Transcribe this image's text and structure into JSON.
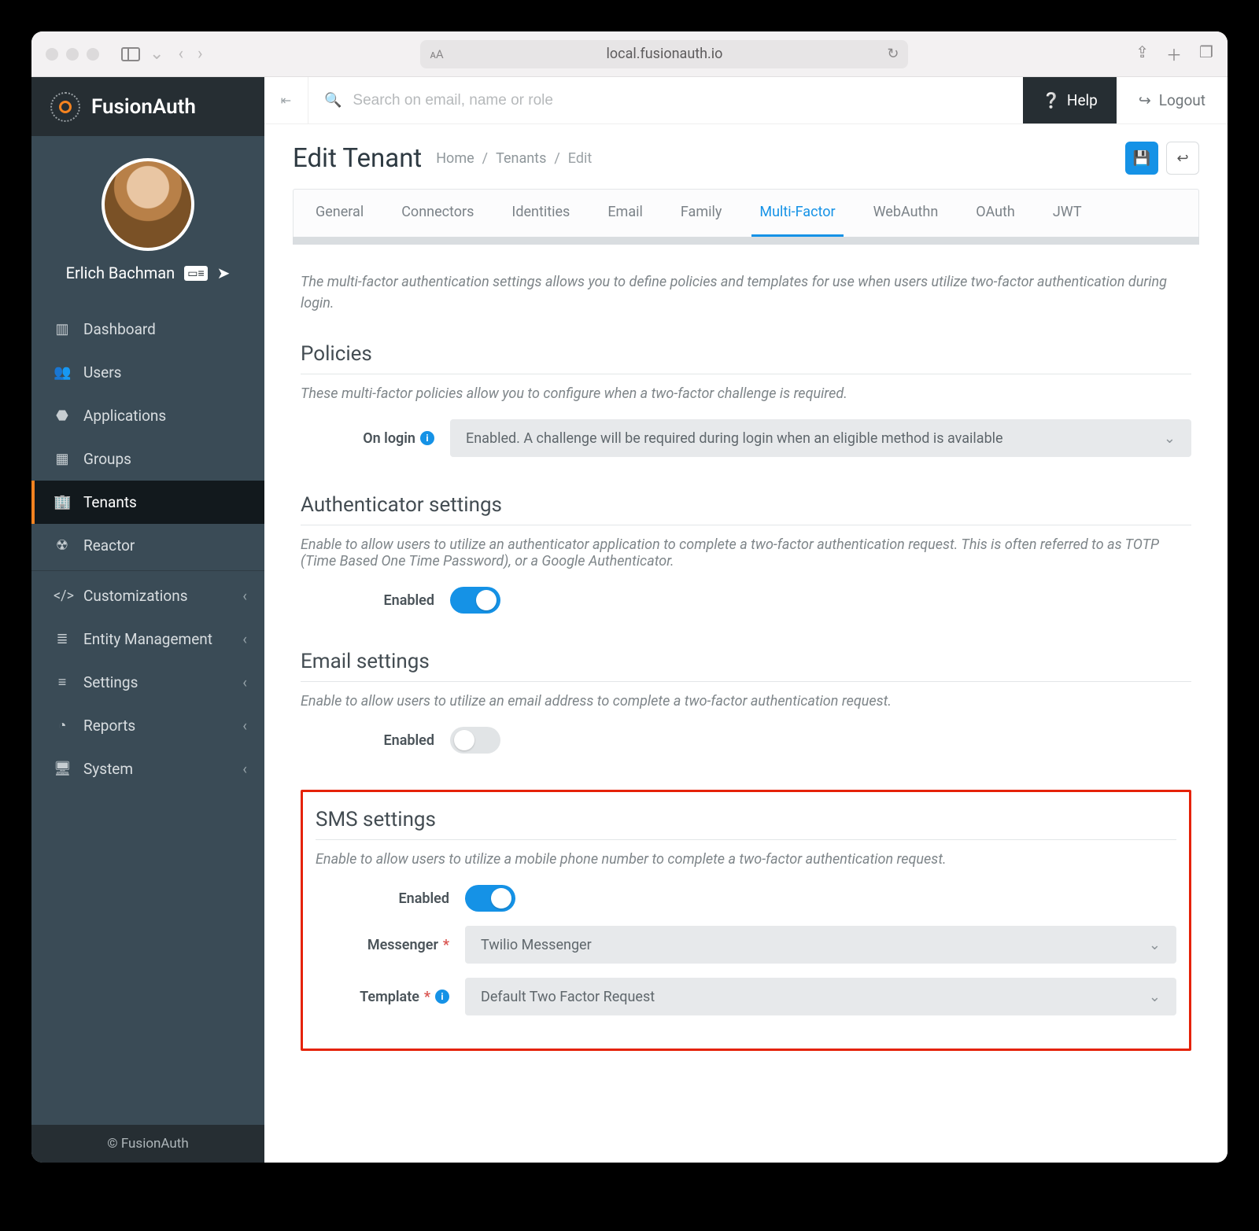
{
  "browser": {
    "url": "local.fusionauth.io"
  },
  "brand": "FusionAuth",
  "user": {
    "name": "Erlich Bachman"
  },
  "sidebar": {
    "items": [
      {
        "label": "Dashboard"
      },
      {
        "label": "Users"
      },
      {
        "label": "Applications"
      },
      {
        "label": "Groups"
      },
      {
        "label": "Tenants"
      },
      {
        "label": "Reactor"
      },
      {
        "label": "Customizations"
      },
      {
        "label": "Entity Management"
      },
      {
        "label": "Settings"
      },
      {
        "label": "Reports"
      },
      {
        "label": "System"
      }
    ],
    "footer": "© FusionAuth"
  },
  "topbar": {
    "search_placeholder": "Search on email, name or role",
    "help": "Help",
    "logout": "Logout"
  },
  "header": {
    "title": "Edit Tenant",
    "crumbs": [
      "Home",
      "Tenants",
      "Edit"
    ]
  },
  "tabs": [
    "General",
    "Connectors",
    "Identities",
    "Email",
    "Family",
    "Multi-Factor",
    "WebAuthn",
    "OAuth",
    "JWT"
  ],
  "content": {
    "intro": "The multi-factor authentication settings allows you to define policies and templates for use when users utilize two-factor authentication during login.",
    "policies": {
      "title": "Policies",
      "desc": "These multi-factor policies allow you to configure when a two-factor challenge is required.",
      "onlogin_label": "On login",
      "onlogin_value": "Enabled. A challenge will be required during login when an eligible method is available"
    },
    "authenticator": {
      "title": "Authenticator settings",
      "desc": "Enable to allow users to utilize an authenticator application to complete a two-factor authentication request. This is often referred to as TOTP (Time Based One Time Password), or a Google Authenticator.",
      "enabled_label": "Enabled"
    },
    "email": {
      "title": "Email settings",
      "desc": "Enable to allow users to utilize an email address to complete a two-factor authentication request.",
      "enabled_label": "Enabled"
    },
    "sms": {
      "title": "SMS settings",
      "desc": "Enable to allow users to utilize a mobile phone number to complete a two-factor authentication request.",
      "enabled_label": "Enabled",
      "messenger_label": "Messenger",
      "messenger_value": "Twilio Messenger",
      "template_label": "Template",
      "template_value": "Default Two Factor Request"
    }
  }
}
